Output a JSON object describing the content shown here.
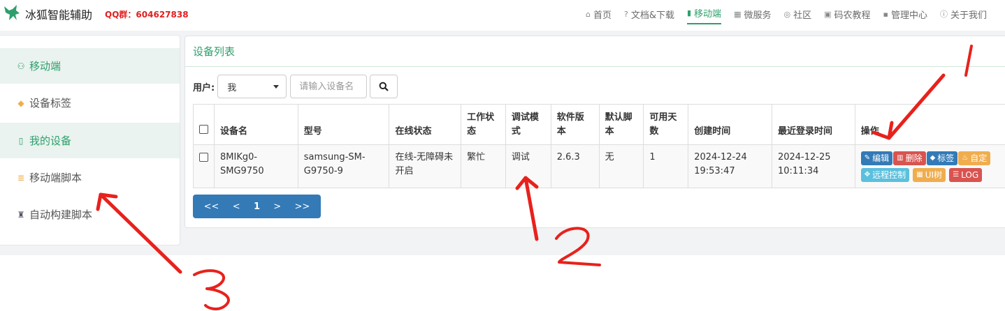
{
  "header": {
    "brand_name": "冰狐智能辅助",
    "qq_group": "QQ群：604627838",
    "nav": [
      {
        "icon": "home-icon",
        "glyph": "⌂",
        "label": "首页"
      },
      {
        "icon": "question-icon",
        "glyph": "?",
        "label": "文档&下载"
      },
      {
        "icon": "phone-icon",
        "glyph": "▮",
        "label": "移动端"
      },
      {
        "icon": "calendar-icon",
        "glyph": "▦",
        "label": "微服务"
      },
      {
        "icon": "chat-icon",
        "glyph": "◎",
        "label": "社区"
      },
      {
        "icon": "book-icon",
        "glyph": "▣",
        "label": "码农教程"
      },
      {
        "icon": "grid-icon",
        "glyph": "▪",
        "label": "管理中心"
      },
      {
        "icon": "info-icon",
        "glyph": "ⓘ",
        "label": "关于我们"
      }
    ]
  },
  "sidebar": {
    "items": [
      {
        "label": "移动端",
        "icon": "user-icon",
        "glyph": "⚇"
      },
      {
        "label": "设备标签",
        "icon": "tag-icon",
        "glyph": "◆"
      },
      {
        "label": "我的设备",
        "icon": "devices-icon",
        "glyph": "▯"
      },
      {
        "label": "移动端脚本",
        "icon": "script-icon",
        "glyph": "≣"
      },
      {
        "label": "自动构建脚本",
        "icon": "builder-icon",
        "glyph": "♜"
      }
    ]
  },
  "panel": {
    "title": "设备列表",
    "filter_label": "用户:",
    "user_select": "我",
    "device_placeholder": "请输入设备名"
  },
  "table": {
    "headers": [
      "设备名",
      "型号",
      "在线状态",
      "工作状态",
      "调试模式",
      "软件版本",
      "默认脚本",
      "可用天数",
      "创建时间",
      "最近登录时间",
      "操作"
    ],
    "rows": [
      {
        "device_name": "8MIKg0-SMG9750",
        "model": "samsung-SM-G9750-9",
        "online_status": "在线-无障碍未开启",
        "work_status": "繁忙",
        "debug_mode": "调试",
        "version": "2.6.3",
        "default_script": "无",
        "days": "1",
        "created": "2024-12-24 19:53:47",
        "last_login": "2024-12-25 10:11:34",
        "actions": [
          {
            "label": "编辑",
            "icon": "edit-icon",
            "glyph": "✎",
            "color": "#337ab7"
          },
          {
            "label": "删除",
            "icon": "trash-icon",
            "glyph": "▥",
            "color": "#d9534f"
          },
          {
            "label": "标签",
            "icon": "tag-icon",
            "glyph": "◆",
            "color": "#337ab7"
          },
          {
            "label": "自定",
            "icon": "fire-icon",
            "glyph": "♨",
            "color": "#f0ad4e"
          },
          {
            "label": "远程控制",
            "icon": "crosshair-icon",
            "glyph": "✥",
            "color": "#5bc0de"
          },
          {
            "label": "UI树",
            "icon": "grid-icon",
            "glyph": "▦",
            "color": "#f0ad4e"
          },
          {
            "label": "LOG",
            "icon": "list-icon",
            "glyph": "☰",
            "color": "#d9534f"
          }
        ]
      }
    ]
  },
  "pager": {
    "first": "<<",
    "prev": "<",
    "current": "1",
    "next": ">",
    "last": ">>"
  },
  "annotations": {
    "label1": "1",
    "label2": "2",
    "label3": "3",
    "color": "#e8211c"
  }
}
